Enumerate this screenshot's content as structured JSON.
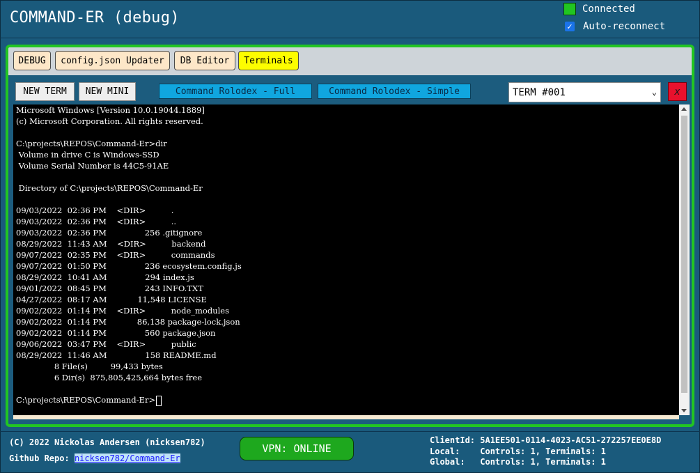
{
  "app": {
    "title": "COMMAND-ER (debug)",
    "connected_label": "Connected",
    "auto_reconnect_label": "Auto-reconnect"
  },
  "tabs": [
    {
      "label": "DEBUG",
      "active": false
    },
    {
      "label": "config.json Updater",
      "active": false
    },
    {
      "label": "DB Editor",
      "active": false
    },
    {
      "label": "Terminals",
      "active": true
    }
  ],
  "toolbar": {
    "new_term": "NEW TERM",
    "new_mini": "NEW MINI",
    "rolodex_full": "Command Rolodex - Full",
    "rolodex_simple": "Command Rolodex - Simple",
    "selected_terminal": "TERM #001",
    "close_label": "x"
  },
  "terminal": {
    "lines": [
      "Microsoft Windows [Version 10.0.19044.1889]",
      "(c) Microsoft Corporation. All rights reserved.",
      "",
      "C:\\projects\\REPOS\\Command-Er>dir",
      " Volume in drive C is Windows-SSD",
      " Volume Serial Number is 44C5-91AE",
      "",
      " Directory of C:\\projects\\REPOS\\Command-Er",
      "",
      "09/03/2022  02:36 PM    <DIR>          .",
      "09/03/2022  02:36 PM    <DIR>          ..",
      "09/03/2022  02:36 PM               256 .gitignore",
      "08/29/2022  11:43 AM    <DIR>          backend",
      "09/07/2022  02:35 PM    <DIR>          commands",
      "09/07/2022  01:50 PM               236 ecosystem.config.js",
      "08/29/2022  10:41 AM               294 index.js",
      "09/01/2022  08:45 PM               243 INFO.TXT",
      "04/27/2022  08:17 AM            11,548 LICENSE",
      "09/02/2022  01:14 PM    <DIR>          node_modules",
      "09/02/2022  01:14 PM            86,138 package-lock.json",
      "09/02/2022  01:14 PM               560 package.json",
      "09/06/2022  03:47 PM    <DIR>          public",
      "08/29/2022  11:46 AM               158 README.md",
      "               8 File(s)         99,433 bytes",
      "               6 Dir(s)  875,805,425,664 bytes free",
      ""
    ],
    "prompt": "C:\\projects\\REPOS\\Command-Er>"
  },
  "footer": {
    "copyright": "(C) 2022 Nickolas Andersen (nicksen782)",
    "repo_label": "Github Repo:",
    "repo_link": "nicksen782/Command-Er",
    "vpn_status": "VPN: ONLINE",
    "client_id_line": "ClientId: 5A1EE501-0114-4023-AC51-272257EE0E8D",
    "local_line": "Local:    Controls: 1, Terminals: 1",
    "global_line": "Global:   Controls: 1, Terminals: 1"
  },
  "colors": {
    "background": "#1a5a7c",
    "panel_border": "#22c522",
    "connected": "#21c521",
    "active_tab": "#fdfd00",
    "rolodex_button": "#10a6df",
    "close_button": "#e8112d"
  }
}
